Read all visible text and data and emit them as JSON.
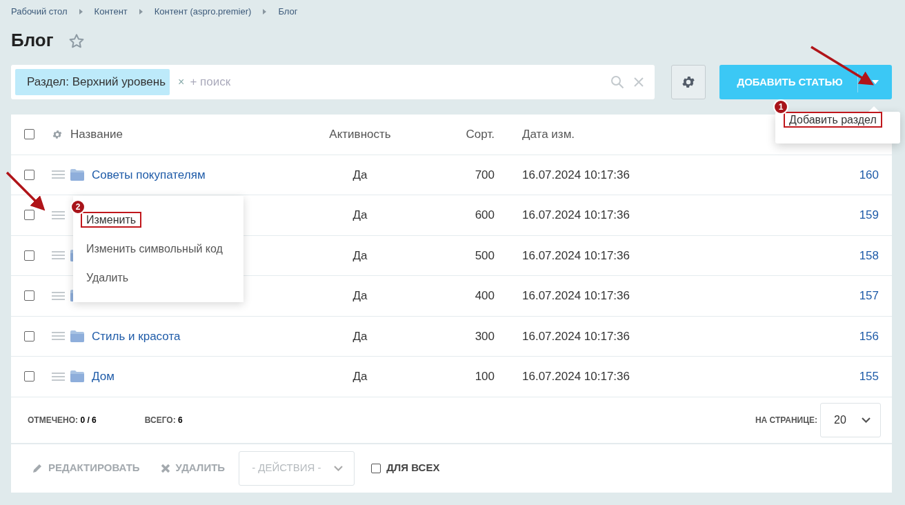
{
  "breadcrumbs": [
    "Рабочий стол",
    "Контент",
    "Контент (aspro.premier)",
    "Блог"
  ],
  "title": "Блог",
  "filter": {
    "tag": "Раздел: Верхний уровень",
    "placeholder": "+ поиск",
    "remove": "×"
  },
  "add_button": {
    "label": "ДОБАВИТЬ СТАТЬЮ",
    "dropdown_open": true,
    "menu": [
      {
        "label": "Добавить раздел",
        "badge": "1",
        "highlighted": true
      }
    ]
  },
  "table": {
    "all_checked": false,
    "columns": [
      "Название",
      "Активность",
      "Сорт.",
      "Дата изм."
    ],
    "rows": [
      {
        "checked": false,
        "folder": true,
        "name": "Советы покупателям",
        "active": "Да",
        "sort": "700",
        "date": "16.07.2024 10:17:36",
        "id": "160"
      },
      {
        "checked": false,
        "folder": false,
        "active": "Да",
        "sort": "600",
        "date": "16.07.2024 10:17:36",
        "id": "159"
      },
      {
        "checked": false,
        "folder": true,
        "active": "Да",
        "sort": "500",
        "date": "16.07.2024 10:17:36",
        "id": "158"
      },
      {
        "checked": false,
        "folder": true,
        "active": "Да",
        "sort": "400",
        "date": "16.07.2024 10:17:36",
        "id": "157"
      },
      {
        "checked": false,
        "folder": true,
        "name": "Стиль и красота",
        "active": "Да",
        "sort": "300",
        "date": "16.07.2024 10:17:36",
        "id": "156"
      },
      {
        "checked": false,
        "folder": true,
        "name": "Дом",
        "active": "Да",
        "sort": "100",
        "date": "16.07.2024 10:17:36",
        "id": "155"
      }
    ]
  },
  "context_menu": [
    {
      "label": "Изменить",
      "badge": "2",
      "highlighted": true
    },
    {
      "label": "Изменить символьный код",
      "highlighted": false
    },
    {
      "label": "Удалить",
      "highlighted": false
    }
  ],
  "footer": {
    "marked_label": "ОТМЕЧЕНО:",
    "marked_value": "0 / 6",
    "total_label": "ВСЕГО:",
    "total_value": "6",
    "per_page_label": "НА СТРАНИЦЕ:",
    "per_page": "20"
  },
  "actions": {
    "edit": "РЕДАКТИРОВАТЬ",
    "delete": "УДАЛИТЬ",
    "select_placeholder": "- ДЕЙСТВИЯ -",
    "for_all": "ДЛЯ ВСЕХ",
    "for_all_checked": false
  }
}
